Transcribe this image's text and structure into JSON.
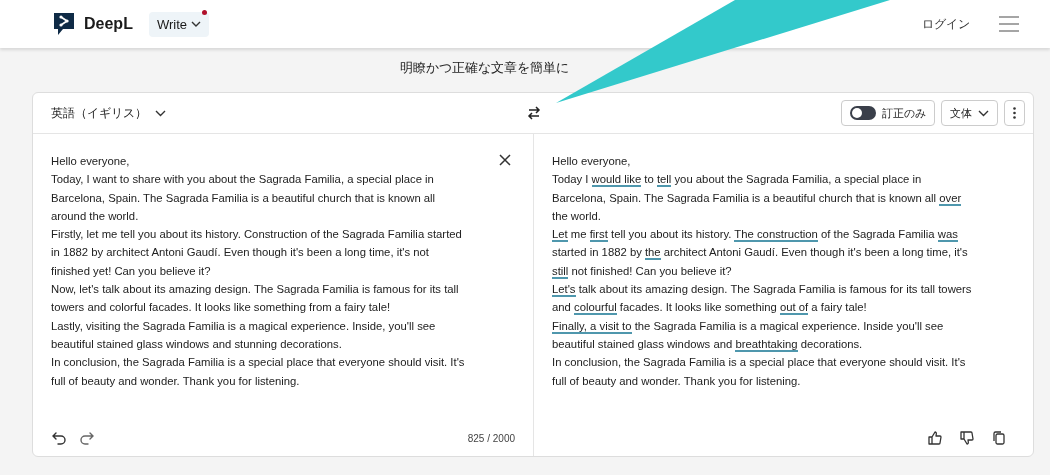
{
  "header": {
    "brand": "DeepL",
    "product_menu": {
      "label": "Write",
      "notification": true
    },
    "login": "ログイン"
  },
  "subtitle": "明瞭かつ正確な文章を簡単に",
  "toolbar": {
    "language": "英語（イギリス）",
    "correction_toggle": {
      "label": "訂正のみ",
      "on": false
    },
    "style_menu": "文体"
  },
  "source": {
    "paragraphs": [
      "Hello everyone,",
      "Today, I want to share with you about the Sagrada Familia, a special place in Barcelona, Spain. The Sagrada Familia is a beautiful church that is known all around the world.",
      "Firstly, let me tell you about its history. Construction of the Sagrada Familia started in 1882 by architect Antoni Gaudí. Even though it's been a long time, it's not finished yet! Can you believe it?",
      "Now, let's talk about its amazing design. The Sagrada Familia is famous for its tall towers and colorful facades. It looks like something from a fairy tale!",
      "Lastly, visiting the Sagrada Familia is a magical experience. Inside, you'll see beautiful stained glass windows and stunning decorations.",
      "In conclusion, the Sagrada Familia is a special place that everyone should visit. It's full of beauty and wonder. Thank you for listening."
    ],
    "char_count": "825 / 2000"
  },
  "result": {
    "paragraphs": [
      [
        {
          "text": "Hello everyone,",
          "changed": false
        }
      ],
      [
        {
          "text": "Today I ",
          "changed": false
        },
        {
          "text": "would like",
          "changed": true
        },
        {
          "text": " to ",
          "changed": false
        },
        {
          "text": "tell",
          "changed": true
        },
        {
          "text": " you about the Sagrada Familia, a special place in Barcelona, Spain. The Sagrada Familia is a beautiful church that is known all ",
          "changed": false
        },
        {
          "text": "over",
          "changed": true
        },
        {
          "text": " the world.",
          "changed": false
        }
      ],
      [
        {
          "text": "Let",
          "changed": true
        },
        {
          "text": " me ",
          "changed": false
        },
        {
          "text": "first",
          "changed": true
        },
        {
          "text": " tell you about its history. ",
          "changed": false
        },
        {
          "text": "The construction",
          "changed": true
        },
        {
          "text": " of the Sagrada Familia ",
          "changed": false
        },
        {
          "text": "was",
          "changed": true
        },
        {
          "text": " started in 1882 by ",
          "changed": false
        },
        {
          "text": "the",
          "changed": true
        },
        {
          "text": " architect Antoni Gaudí. Even though it's been a long time, it's ",
          "changed": false
        },
        {
          "text": "still",
          "changed": true
        },
        {
          "text": " not finished! Can you believe it?",
          "changed": false
        }
      ],
      [
        {
          "text": "Let's",
          "changed": true
        },
        {
          "text": " talk about its amazing design. The Sagrada Familia is famous for its tall towers and ",
          "changed": false
        },
        {
          "text": "colourful",
          "changed": true
        },
        {
          "text": " facades. It looks like something ",
          "changed": false
        },
        {
          "text": "out of",
          "changed": true
        },
        {
          "text": " a fairy tale!",
          "changed": false
        }
      ],
      [
        {
          "text": "Finally, ",
          "changed": true
        },
        {
          "text": "a visit to",
          "changed": true
        },
        {
          "text": " the Sagrada Familia is a magical experience. Inside you'll see beautiful stained glass windows and ",
          "changed": false
        },
        {
          "text": "breathtaking",
          "changed": true
        },
        {
          "text": " decorations.",
          "changed": false
        }
      ],
      [
        {
          "text": "In conclusion, the Sagrada Familia is a special place that everyone should visit. It's full of beauty and wonder. Thank you for listening.",
          "changed": false
        }
      ]
    ]
  }
}
